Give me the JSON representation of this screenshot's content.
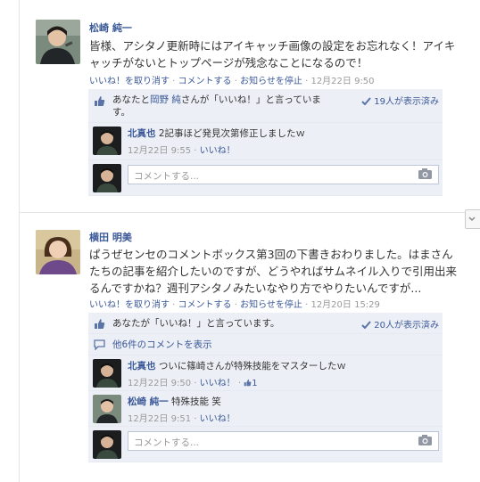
{
  "posts": [
    {
      "author": "松崎 純一",
      "text": "皆様、アシタノ更新時にはアイキャッチ画像の設定をお忘れなく！アイキャッチがないとトップページが残念なことになるので！",
      "actions": {
        "like": "いいね！を取り消す",
        "comment": "コメントする",
        "unsubscribe": "お知らせを停止",
        "time": "12月22日 9:50",
        "sep": " · "
      },
      "likes": {
        "prefix": "あなたと",
        "name": "岡野 純",
        "suffix": "さんが「いいね！」と言っていま",
        "suffix2": "す。",
        "seen": "19人が表示済み"
      },
      "comments": [
        {
          "author": "北真也",
          "text": "2記事ほど発見次第修正しましたｗ",
          "time": "12月22日 9:55",
          "like": "いいね！"
        }
      ],
      "input_placeholder": "コメントする..."
    },
    {
      "author": "横田 明美",
      "text": "ぱうぜセンセのコメントボックス第3回の下書きおわりました。はまさんたちの記事を紹介したいのですが、どうやればサムネイル入りで引用出来るんですかね？週刊アシタノみたいなやり方でやりたいんですが...",
      "actions": {
        "like": "いいね！を取り消す",
        "comment": "コメントする",
        "unsubscribe": "お知らせを停止",
        "time": "12月20日 15:29",
        "sep": " · "
      },
      "likes": {
        "text": "あなたが「いいね！」と言っています。",
        "seen": "20人が表示済み"
      },
      "view_more": "他6件のコメントを表示",
      "comments": [
        {
          "author": "北真也",
          "text": "ついに篠崎さんが特殊技能をマスターしたｗ",
          "time": "12月22日 9:50",
          "like": "いいね！",
          "like_count": "1"
        },
        {
          "author": "松崎 純一",
          "text": "特殊技能 笑",
          "time": "12月22日 9:51",
          "like": "いいね！"
        }
      ],
      "input_placeholder": "コメントする..."
    }
  ]
}
